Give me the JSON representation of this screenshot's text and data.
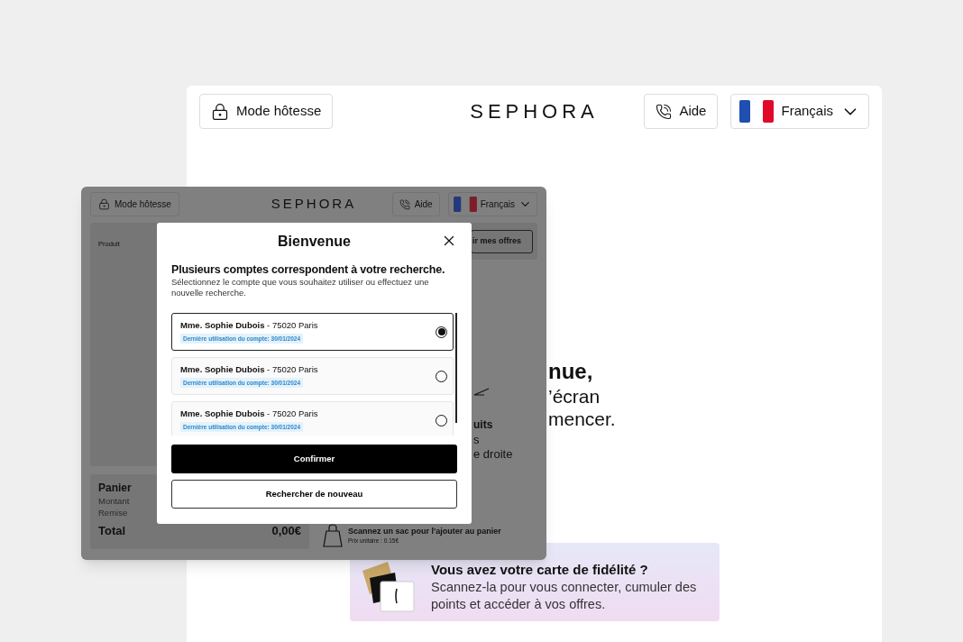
{
  "kiosk": {
    "host_mode": "Mode hôtesse",
    "logo": "SEPHORA",
    "help": "Aide",
    "language": "Français",
    "welcome_fragments": [
      "nue,",
      "’écran",
      "mencer."
    ],
    "loyalty": {
      "title": "Vous avez votre carte de fidélité ?",
      "text": "Scannez-la pour vous connecter, cumuler des points et accéder à vos offres."
    }
  },
  "inset": {
    "host_mode": "Mode hôtesse",
    "logo": "SEPHORA",
    "help": "Aide",
    "language": "Français",
    "offers_button": "ir mes offres",
    "product_label": "Produit",
    "fragments": [
      "uits",
      "s",
      "e droite"
    ],
    "cart": {
      "title": "Panier",
      "rows": [
        "Montant",
        "Remise"
      ],
      "total_label": "Total",
      "total": "0,00€"
    },
    "bag": {
      "title": "Scannez un sac pour l'ajouter au panier",
      "price": "Prix unitaire : 0.15€"
    }
  },
  "dialog": {
    "title": "Bienvenue",
    "heading": "Plusieurs comptes correspondent à votre recherche.",
    "description": "Sélectionnez le compte que vous souhaitez utiliser ou effectuez une nouvelle recherche.",
    "accounts": [
      {
        "name": "Mme. Sophie Dubois",
        "location": "- 75020 Paris",
        "last_used": "Dernière utilisation du compte: 30/01/2024",
        "selected": true
      },
      {
        "name": "Mme. Sophie Dubois",
        "location": "- 75020 Paris",
        "last_used": "Dernière utilisation du compte: 30/01/2024",
        "selected": false
      },
      {
        "name": "Mme. Sophie Dubois",
        "location": "- 75020 Paris",
        "last_used": "Dernière utilisation du compte: 30/01/2024",
        "selected": false
      }
    ],
    "buttons": [
      {
        "label": "Confirmer",
        "kind": "primary"
      },
      {
        "label": "Rechercher de nouveau",
        "kind": "secondary"
      }
    ]
  }
}
